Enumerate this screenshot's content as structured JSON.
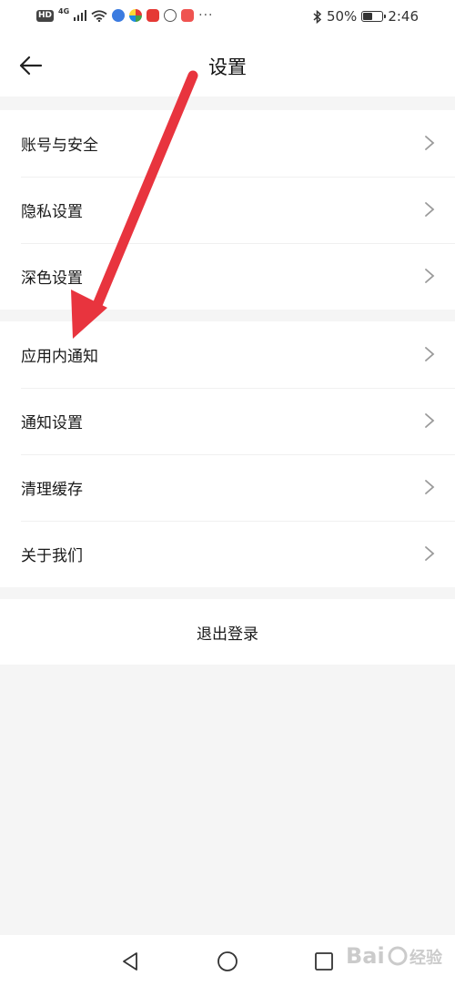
{
  "status_bar": {
    "hd_badge": "HD",
    "network": "4G",
    "more_dots": "···",
    "battery_text": "50%",
    "battery_level": 0.5,
    "time": "2:46",
    "icons": [
      "hd-icon",
      "signal-icon",
      "wifi-icon",
      "music-app-icon",
      "browser-app-icon",
      "video-app-icon",
      "shield-app-icon",
      "y-app-icon",
      "bluetooth-icon",
      "battery-icon"
    ]
  },
  "header": {
    "title": "设置",
    "back_icon": "back-arrow-icon"
  },
  "settings": {
    "group1": [
      {
        "label": "账号与安全"
      },
      {
        "label": "隐私设置"
      },
      {
        "label": "深色设置"
      }
    ],
    "group2": [
      {
        "label": "应用内通知"
      },
      {
        "label": "通知设置"
      },
      {
        "label": "清理缓存"
      },
      {
        "label": "关于我们"
      }
    ]
  },
  "logout": {
    "label": "退出登录"
  },
  "annotation": {
    "arrow_color": "#e8343e"
  },
  "colors": {
    "background": "#f5f5f5",
    "card": "#ffffff",
    "text": "#1a1a1a",
    "chevron": "#9a9a9a"
  }
}
